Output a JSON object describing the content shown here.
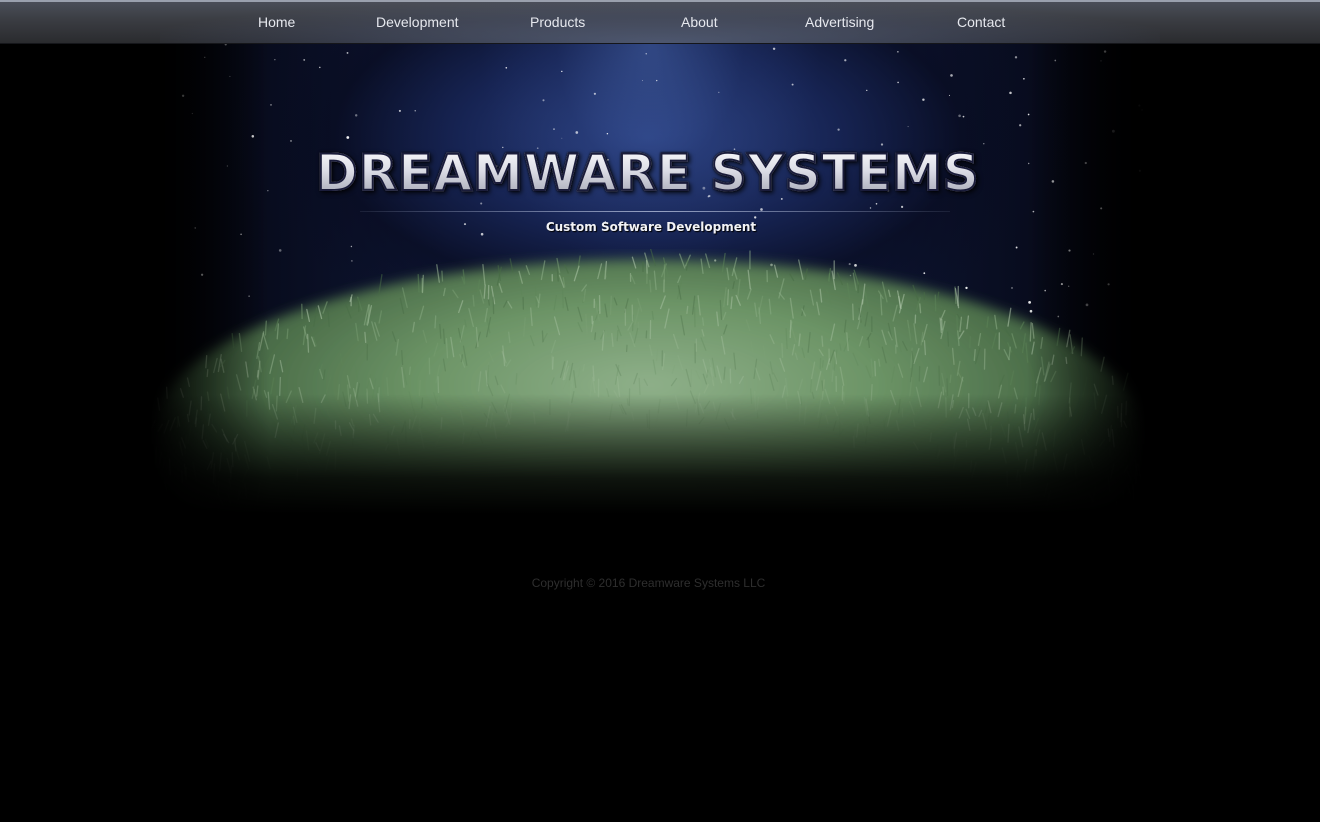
{
  "nav": {
    "items": [
      {
        "label": "Home"
      },
      {
        "label": "Development"
      },
      {
        "label": "Products"
      },
      {
        "label": "About"
      },
      {
        "label": "Advertising"
      },
      {
        "label": "Contact"
      }
    ]
  },
  "hero": {
    "title": "DREAMWARE SYSTEMS",
    "tagline": "Custom Software Development"
  },
  "footer": {
    "copyright": "Copyright © 2016 Dreamware Systems LLC"
  },
  "colors": {
    "background": "#000000",
    "nav_text": "#e6e8ee",
    "sky_glow": "#304890",
    "grass": "#5f8a5a",
    "footer_text": "#2e2e2e"
  }
}
